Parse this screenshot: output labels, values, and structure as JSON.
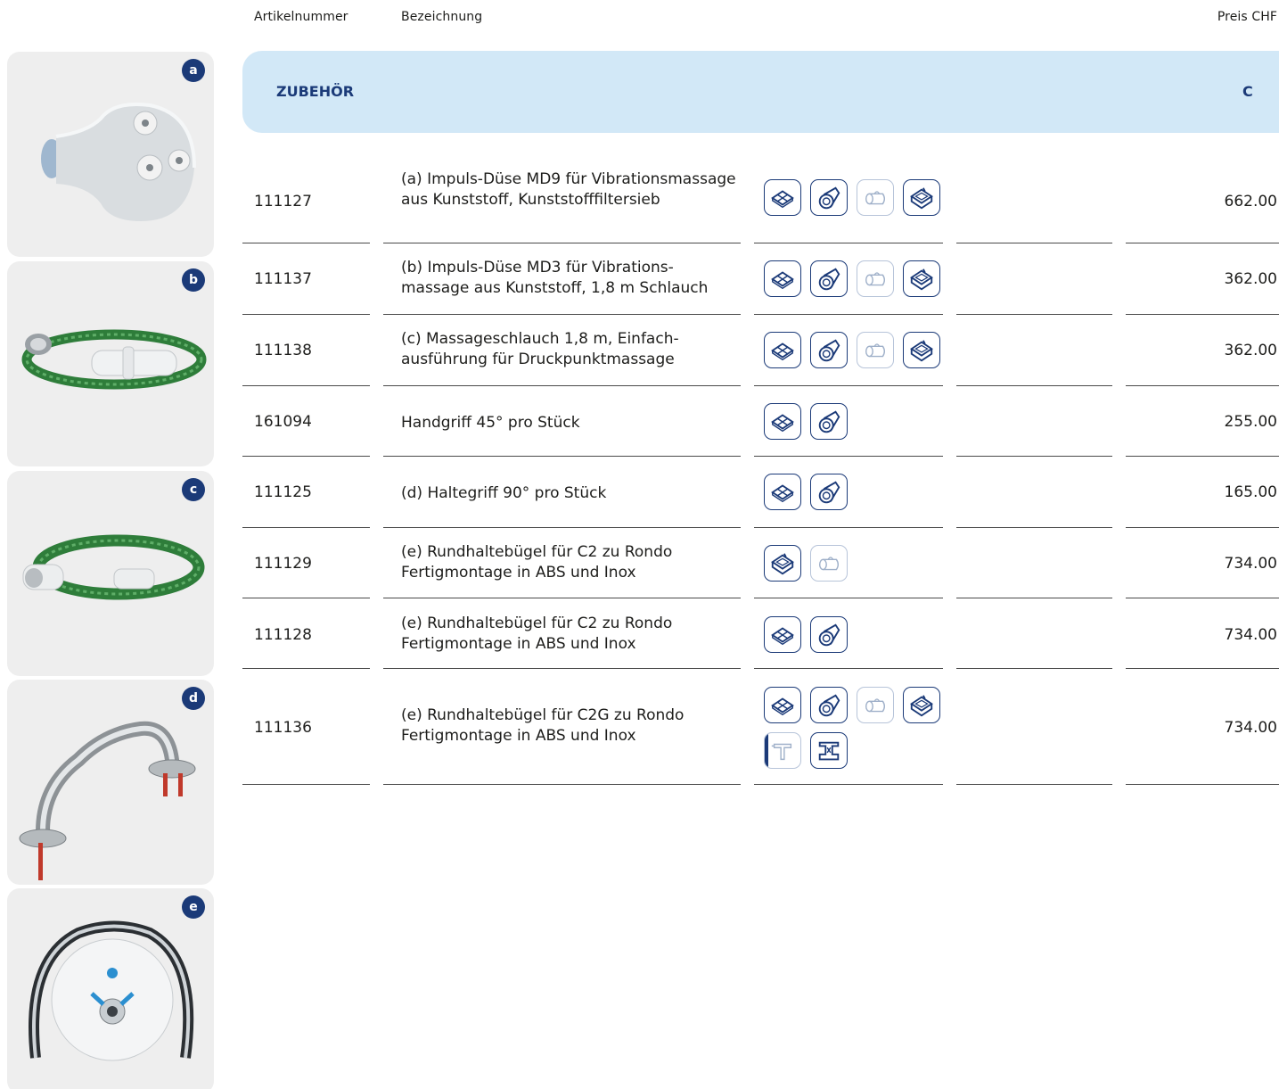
{
  "headers": {
    "article_number": "Artikelnummer",
    "description": "Bezeichnung",
    "price": "Preis CHF"
  },
  "section": {
    "title": "ZUBEHÖR",
    "code": "C"
  },
  "thumbnails": [
    {
      "letter": "a",
      "icon": "impulse-nozzle-image"
    },
    {
      "letter": "b",
      "icon": "massage-hose-nozzle-image"
    },
    {
      "letter": "c",
      "icon": "massage-hose-image"
    },
    {
      "letter": "d",
      "icon": "grab-handle-image"
    },
    {
      "letter": "e",
      "icon": "round-handle-image"
    }
  ],
  "rows": [
    {
      "number": "111127",
      "description": "(a) Impuls-Düse MD9 für Vibrationsmassage aus Kunststoff, Kunststofffiltersieb",
      "price": "662.00",
      "icons": [
        "tile-icon",
        "liner-icon",
        "wood-icon",
        "steel-tub-icon"
      ]
    },
    {
      "number": "111137",
      "description": "(b) Impuls-Düse MD3 für Vibrations-massage aus Kunststoff, 1,8 m Schlauch",
      "price": "362.00",
      "icons": [
        "tile-icon",
        "liner-icon",
        "wood-icon",
        "steel-tub-icon"
      ]
    },
    {
      "number": "111138",
      "description": "(c) Massageschlauch 1,8 m, Einfach-ausführung für Druckpunktmassage",
      "price": "362.00",
      "icons": [
        "tile-icon",
        "liner-icon",
        "wood-icon",
        "steel-tub-icon"
      ]
    },
    {
      "number": "161094",
      "description": "Handgriff 45° pro Stück",
      "price": "255.00",
      "icons": [
        "tile-icon",
        "liner-icon"
      ]
    },
    {
      "number": "111125",
      "description": "(d) Haltegriff 90° pro Stück",
      "price": "165.00",
      "icons": [
        "tile-icon",
        "liner-icon"
      ]
    },
    {
      "number": "111129",
      "description": "(e) Rundhaltebügel für C2 zu Rondo Fertigmontage in ABS und Inox",
      "price": "734.00",
      "icons": [
        "steel-tub-icon",
        "wood-icon"
      ]
    },
    {
      "number": "111128",
      "description": "(e) Rundhaltebügel für C2 zu Rondo Fertigmontage in ABS und Inox",
      "price": "734.00",
      "icons": [
        "tile-icon",
        "liner-icon"
      ]
    },
    {
      "number": "111136",
      "description": "(e) Rundhaltebügel für C2G zu Rondo Fertigmontage in ABS und Inox",
      "price": "734.00",
      "icons": [
        "tile-icon",
        "liner-icon",
        "wood-icon",
        "steel-tub-icon",
        "drill-icon",
        "concrete-icon"
      ]
    }
  ]
}
